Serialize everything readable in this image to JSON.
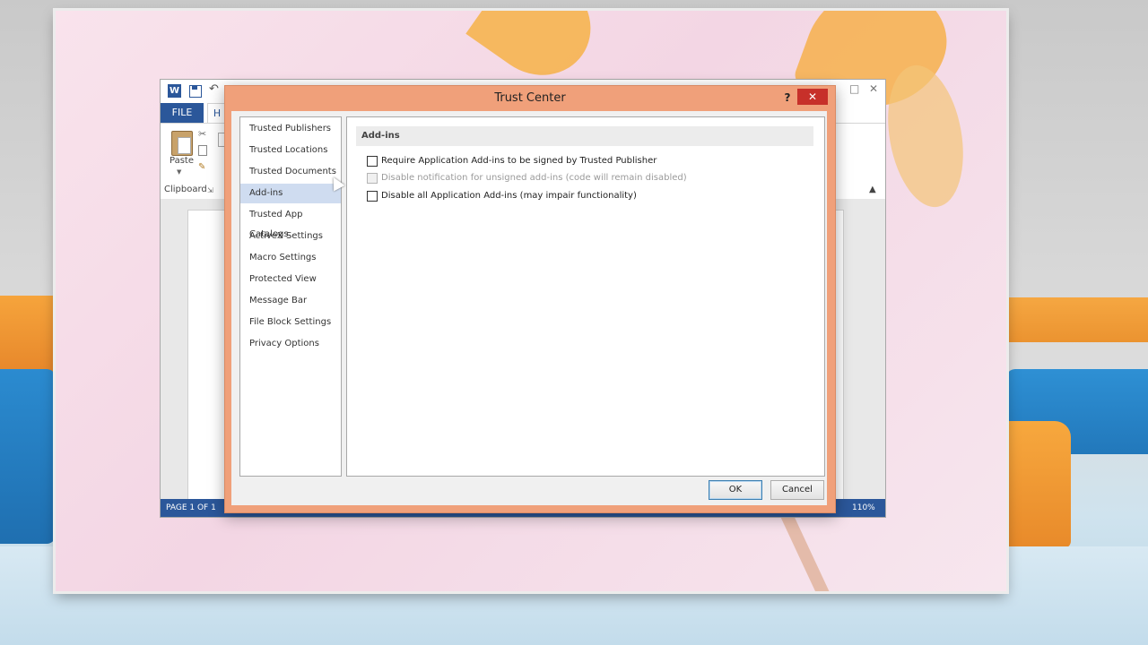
{
  "word": {
    "file_tab": "FILE",
    "home_tab": "H",
    "paste_label": "Paste",
    "clipboard_label": "Clipboard",
    "status_page": "PAGE 1 OF 1",
    "status_zoom": "110%",
    "window_controls": {
      "minimize": "–",
      "maximize": "□",
      "close": "✕"
    }
  },
  "dialog": {
    "title": "Trust Center",
    "help_label": "?",
    "close_label": "✕",
    "nav_items": [
      {
        "label": "Trusted Publishers",
        "selected": false
      },
      {
        "label": "Trusted Locations",
        "selected": false
      },
      {
        "label": "Trusted Documents",
        "selected": false
      },
      {
        "label": "Add-ins",
        "selected": true
      },
      {
        "label": "Trusted App Catalogs",
        "selected": false
      },
      {
        "label": "ActiveX Settings",
        "selected": false
      },
      {
        "label": "Macro Settings",
        "selected": false
      },
      {
        "label": "Protected View",
        "selected": false
      },
      {
        "label": "Message Bar",
        "selected": false
      },
      {
        "label": "File Block Settings",
        "selected": false
      },
      {
        "label": "Privacy Options",
        "selected": false
      }
    ],
    "section_title": "Add-ins",
    "options": [
      {
        "label": "Require Application Add-ins to be signed by Trusted Publisher",
        "checked": false,
        "enabled": true
      },
      {
        "label": "Disable notification for unsigned add-ins (code will remain disabled)",
        "checked": false,
        "enabled": false
      },
      {
        "label": "Disable all Application Add-ins (may impair functionality)",
        "checked": false,
        "enabled": true
      }
    ],
    "ok_label": "OK",
    "cancel_label": "Cancel"
  },
  "colors": {
    "dialog_frame": "#f0a07a",
    "word_accent": "#2b579a",
    "close_button": "#c7302a",
    "nav_selected": "#cfdcf0"
  }
}
